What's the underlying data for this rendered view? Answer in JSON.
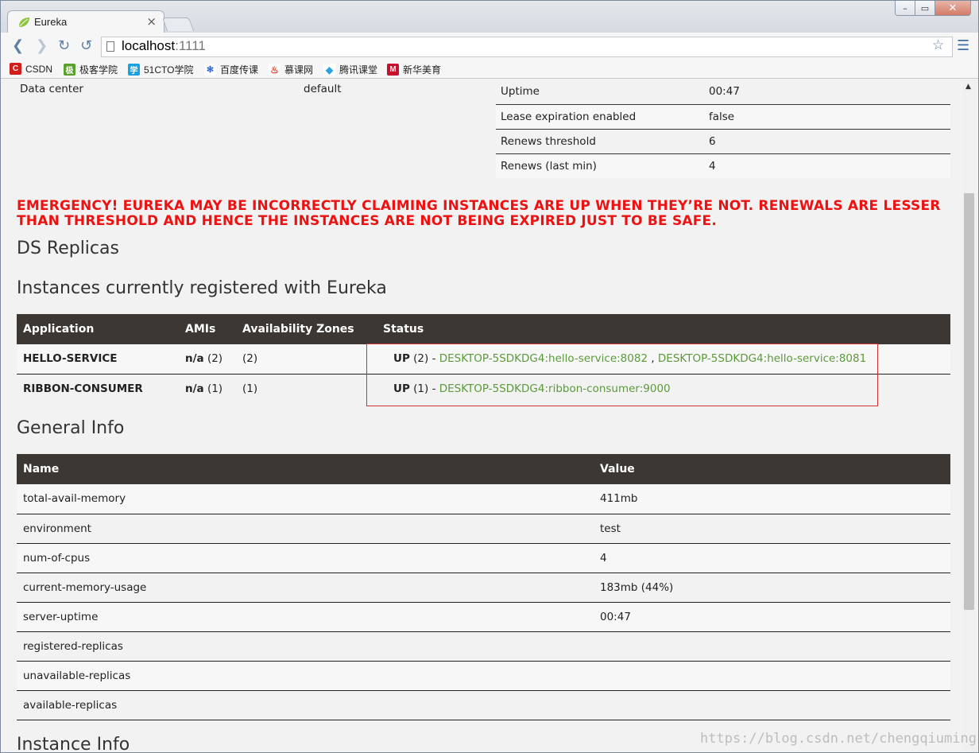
{
  "browser": {
    "tab_title": "Eureka",
    "tab_close": "×",
    "url_host": "localhost",
    "url_port": ":1111",
    "window_buttons": [
      "–",
      "▭",
      "✕"
    ],
    "bookmarks": [
      {
        "label": "CSDN",
        "icon": "csdn-icon",
        "icon_text": "C",
        "color": "#d21d1d"
      },
      {
        "label": "极客学院",
        "icon": "jikexueyuan-icon",
        "icon_text": "极",
        "color": "#5aa02c"
      },
      {
        "label": "51CTO学院",
        "icon": "51cto-icon",
        "icon_text": "学",
        "color": "#1ba1e2"
      },
      {
        "label": "百度传课",
        "icon": "baidu-paw-icon",
        "icon_text": "🐾",
        "color": "#2f66c9"
      },
      {
        "label": "慕课网",
        "icon": "flame-icon",
        "icon_text": "🔥",
        "color": "#ffffff"
      },
      {
        "label": "腾讯课堂",
        "icon": "tencent-icon",
        "icon_text": "◆",
        "color": "#2aa4e0"
      },
      {
        "label": "新华美育",
        "icon": "xinhua-m-icon",
        "icon_text": "M",
        "color": "#c8102e"
      }
    ]
  },
  "environment": {
    "data_center_label": "Data center",
    "data_center_value": "default"
  },
  "stats": [
    {
      "label": "Uptime",
      "value": "00:47"
    },
    {
      "label": "Lease expiration enabled",
      "value": "false"
    },
    {
      "label": "Renews threshold",
      "value": "6"
    },
    {
      "label": "Renews (last min)",
      "value": "4"
    }
  ],
  "emergency_message": "EMERGENCY! EUREKA MAY BE INCORRECTLY CLAIMING INSTANCES ARE UP WHEN THEY’RE NOT. RENEWALS ARE LESSER THAN THRESHOLD AND HENCE THE INSTANCES ARE NOT BEING EXPIRED JUST TO BE SAFE.",
  "headings": {
    "ds_replicas": "DS Replicas",
    "instances": "Instances currently registered with Eureka",
    "general_info": "General Info",
    "instance_info": "Instance Info"
  },
  "instances_table": {
    "headers": [
      "Application",
      "AMIs",
      "Availability Zones",
      "Status"
    ],
    "rows": [
      {
        "application": "HELLO-SERVICE",
        "ami": "n/a",
        "ami_count": "(2)",
        "zones": "(2)",
        "status": "UP",
        "status_count": "(2) - ",
        "links": [
          "DESKTOP-5SDKDG4:hello-service:8082",
          "DESKTOP-5SDKDG4:hello-service:8081"
        ]
      },
      {
        "application": "RIBBON-CONSUMER",
        "ami": "n/a",
        "ami_count": "(1)",
        "zones": "(1)",
        "status": "UP",
        "status_count": "(1) - ",
        "links": [
          "DESKTOP-5SDKDG4:ribbon-consumer:9000"
        ]
      }
    ]
  },
  "general_table": {
    "headers": [
      "Name",
      "Value"
    ],
    "rows": [
      {
        "name": "total-avail-memory",
        "value": "411mb"
      },
      {
        "name": "environment",
        "value": "test"
      },
      {
        "name": "num-of-cpus",
        "value": "4"
      },
      {
        "name": "current-memory-usage",
        "value": "183mb (44%)"
      },
      {
        "name": "server-uptime",
        "value": "00:47"
      },
      {
        "name": "registered-replicas",
        "value": ""
      },
      {
        "name": "unavailable-replicas",
        "value": ""
      },
      {
        "name": "available-replicas",
        "value": ""
      }
    ]
  },
  "watermark": "https://blog.csdn.net/chengqiuming"
}
